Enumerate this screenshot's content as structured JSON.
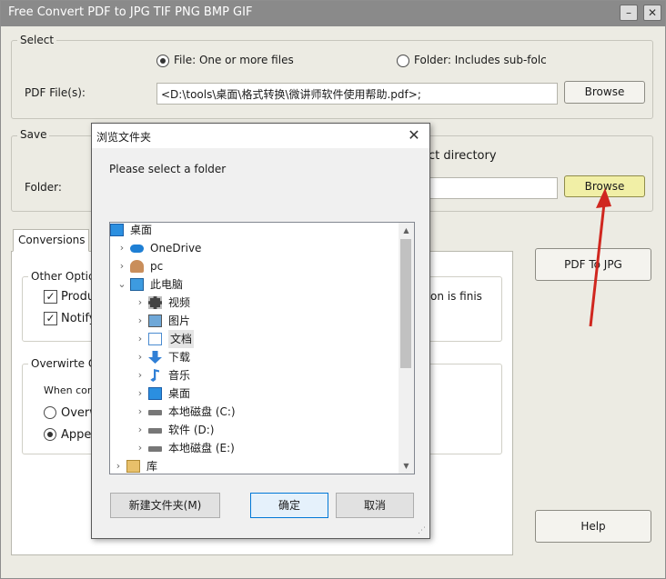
{
  "window": {
    "title": "Free Convert PDF to JPG TIF PNG BMP GIF",
    "minimize": "–",
    "close": "✕"
  },
  "select": {
    "label": "Select",
    "file_option": "File:  One or more files",
    "folder_option": "Folder: Includes sub-folc",
    "pdf_files_label": "PDF File(s):",
    "pdf_files_value": "<D:\\tools\\桌面\\格式转换\\微讲师软件使用帮助.pdf>;",
    "browse": "Browse"
  },
  "save": {
    "label": "Save",
    "select_dir_text": "ect directory",
    "folder_label": "Folder:",
    "folder_value": "",
    "browse": "Browse"
  },
  "tabs": {
    "conversions": "Conversions"
  },
  "other_options": {
    "label": "Other Optic",
    "produce": "Produ",
    "notify": "Notify",
    "finish_text": "on is finis"
  },
  "overwrite": {
    "label": "Overwirte O",
    "when_text": "When conv",
    "overwrite_opt": "Overw",
    "append_opt": "Apper"
  },
  "actions": {
    "pdf_to_jpg": "PDF To JPG",
    "help": "Help"
  },
  "dialog": {
    "title": "浏览文件夹",
    "close": "✕",
    "instruction": "Please select a folder",
    "tree": [
      {
        "label": "桌面",
        "icon": "desktop-icon",
        "indent": 0,
        "chevron": ""
      },
      {
        "label": "OneDrive",
        "icon": "cloud-icon",
        "indent": 1,
        "chevron": "›"
      },
      {
        "label": "pc",
        "icon": "user-icon",
        "indent": 1,
        "chevron": "›"
      },
      {
        "label": "此电脑",
        "icon": "computer-icon",
        "indent": 1,
        "chevron": "⌄"
      },
      {
        "label": "视频",
        "icon": "video-icon",
        "indent": 2,
        "chevron": "›"
      },
      {
        "label": "图片",
        "icon": "picture-icon",
        "indent": 2,
        "chevron": "›"
      },
      {
        "label": "文档",
        "icon": "document-icon",
        "indent": 2,
        "chevron": "›"
      },
      {
        "label": "下载",
        "icon": "download-icon",
        "indent": 2,
        "chevron": "›"
      },
      {
        "label": "音乐",
        "icon": "music-icon",
        "indent": 2,
        "chevron": "›"
      },
      {
        "label": "桌面",
        "icon": "desktop-icon",
        "indent": 2,
        "chevron": "›"
      },
      {
        "label": "本地磁盘 (C:)",
        "icon": "drive-icon",
        "indent": 2,
        "chevron": "›"
      },
      {
        "label": "软件 (D:)",
        "icon": "drive-icon",
        "indent": 2,
        "chevron": "›"
      },
      {
        "label": "本地磁盘 (E:)",
        "icon": "drive-icon",
        "indent": 2,
        "chevron": "›"
      },
      {
        "label": "库",
        "icon": "library-icon",
        "indent": 0,
        "chevron": "›"
      }
    ],
    "new_folder": "新建文件夹(M)",
    "ok": "确定",
    "cancel": "取消"
  },
  "colors": {
    "accent_yellow": "#f1efa6",
    "arrow_red": "#d0271f",
    "selection": "#cce8ff"
  }
}
